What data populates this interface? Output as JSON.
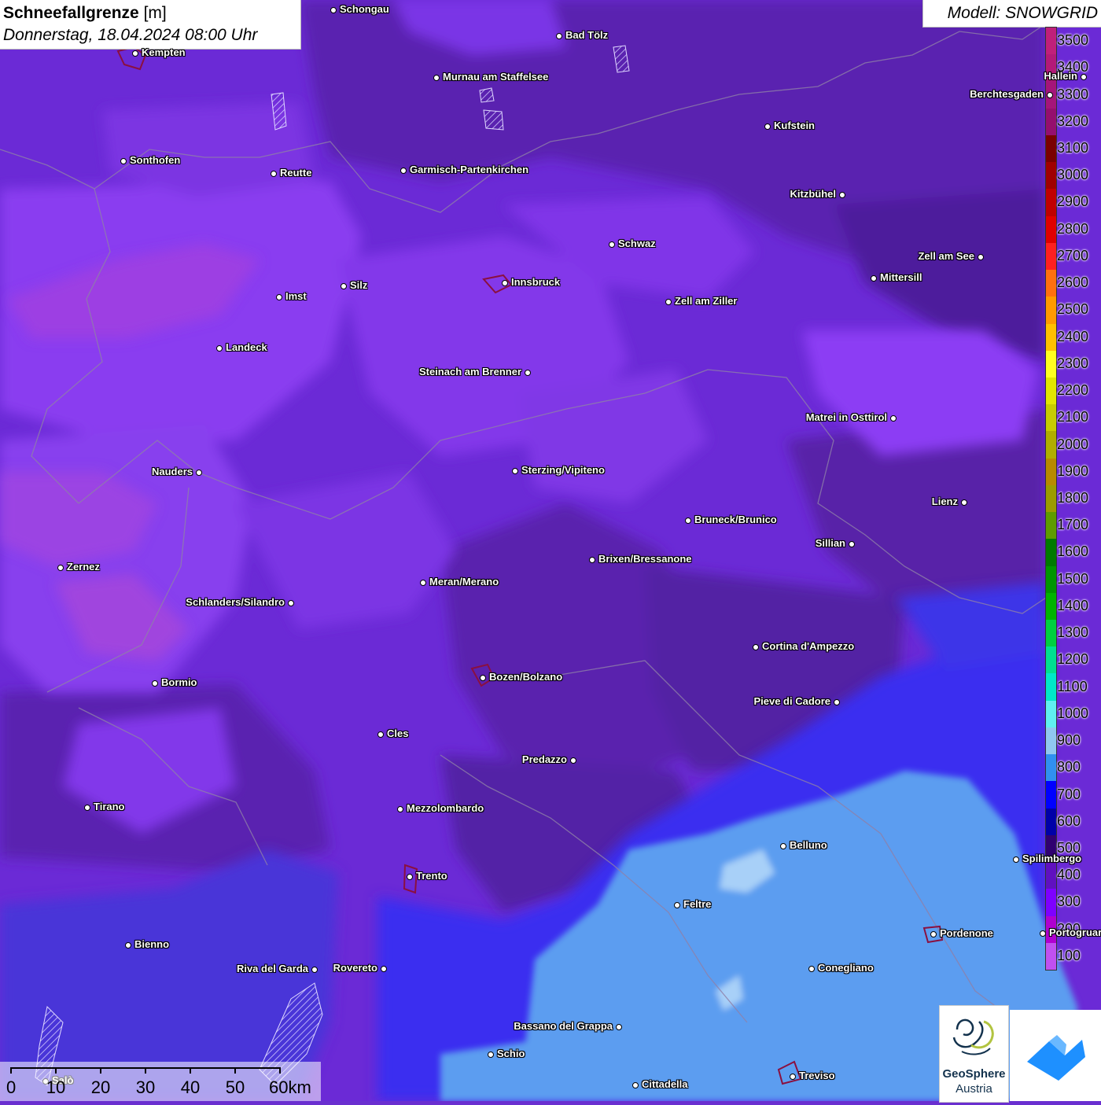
{
  "header": {
    "title": "Schneefallgrenze",
    "unit": "[m]",
    "datetime": "Donnerstag, 18.04.2024 08:00 Uhr"
  },
  "model": {
    "label": "Modell: SNOWGRID"
  },
  "legend": {
    "entries": [
      {
        "label": "3500",
        "color": "#c0207a"
      },
      {
        "label": "3400",
        "color": "#b31a78"
      },
      {
        "label": "3300",
        "color": "#a5157a"
      },
      {
        "label": "3200",
        "color": "#950f6e"
      },
      {
        "label": "3100",
        "color": "#7a0000"
      },
      {
        "label": "3000",
        "color": "#a00000"
      },
      {
        "label": "2900",
        "color": "#c00000"
      },
      {
        "label": "2800",
        "color": "#e00000"
      },
      {
        "label": "2700",
        "color": "#ff2020"
      },
      {
        "label": "2600",
        "color": "#ff7010"
      },
      {
        "label": "2500",
        "color": "#ff9a00"
      },
      {
        "label": "2400",
        "color": "#ffc000"
      },
      {
        "label": "2300",
        "color": "#ffff20"
      },
      {
        "label": "2200",
        "color": "#e2e600"
      },
      {
        "label": "2100",
        "color": "#c8cc00"
      },
      {
        "label": "2000",
        "color": "#b0ae00"
      },
      {
        "label": "1900",
        "color": "#b88a00"
      },
      {
        "label": "1800",
        "color": "#9c9c00"
      },
      {
        "label": "1700",
        "color": "#5e9c00"
      },
      {
        "label": "1600",
        "color": "#007a00"
      },
      {
        "label": "1500",
        "color": "#009600"
      },
      {
        "label": "1400",
        "color": "#00b400"
      },
      {
        "label": "1300",
        "color": "#00d040"
      },
      {
        "label": "1200",
        "color": "#00e090"
      },
      {
        "label": "1100",
        "color": "#00e8c8"
      },
      {
        "label": "1000",
        "color": "#60f0f0"
      },
      {
        "label": "900",
        "color": "#90c8f0"
      },
      {
        "label": "800",
        "color": "#3090f0"
      },
      {
        "label": "700",
        "color": "#0000ff"
      },
      {
        "label": "600",
        "color": "#0000a8"
      },
      {
        "label": "500",
        "color": "#300070"
      },
      {
        "label": "400",
        "color": "#6010c0"
      },
      {
        "label": "300",
        "color": "#7e00ff"
      },
      {
        "label": "200",
        "color": "#b000d0"
      },
      {
        "label": "100",
        "color": "#c050f0"
      }
    ],
    "clipped_label": "00"
  },
  "cities": [
    {
      "name": "Schongau",
      "align": "right"
    },
    {
      "name": "Bad Tölz",
      "align": "right"
    },
    {
      "name": "Kempten",
      "align": "right"
    },
    {
      "name": "Murnau am Staffelsee",
      "align": "right"
    },
    {
      "name": "Hallein",
      "align": "left"
    },
    {
      "name": "Berchtesgaden",
      "align": "left"
    },
    {
      "name": "Kufstein",
      "align": "right"
    },
    {
      "name": "Sonthofen",
      "align": "right"
    },
    {
      "name": "Reutte",
      "align": "right"
    },
    {
      "name": "Garmisch-Partenkirchen",
      "align": "right"
    },
    {
      "name": "Kitzbühel",
      "align": "left"
    },
    {
      "name": "Schwaz",
      "align": "right"
    },
    {
      "name": "Zell am See",
      "align": "left"
    },
    {
      "name": "Mittersill",
      "align": "right"
    },
    {
      "name": "Innsbruck",
      "align": "right"
    },
    {
      "name": "Imst",
      "align": "right"
    },
    {
      "name": "Silz",
      "align": "right"
    },
    {
      "name": "Zell am Ziller",
      "align": "right"
    },
    {
      "name": "Landeck",
      "align": "right"
    },
    {
      "name": "Steinach am Brenner",
      "align": "left"
    },
    {
      "name": "Matrei in Osttirol",
      "align": "left"
    },
    {
      "name": "Nauders",
      "align": "left"
    },
    {
      "name": "Sterzing/Vipiteno",
      "align": "right"
    },
    {
      "name": "Lienz",
      "align": "left"
    },
    {
      "name": "Bruneck/Brunico",
      "align": "right"
    },
    {
      "name": "Sillian",
      "align": "left"
    },
    {
      "name": "Zernez",
      "align": "right"
    },
    {
      "name": "Brixen/Bressanone",
      "align": "right"
    },
    {
      "name": "Meran/Merano",
      "align": "right"
    },
    {
      "name": "Schlanders/Silandro",
      "align": "left"
    },
    {
      "name": "Cortina d'Ampezzo",
      "align": "right"
    },
    {
      "name": "Bozen/Bolzano",
      "align": "right"
    },
    {
      "name": "Bormio",
      "align": "right"
    },
    {
      "name": "Pieve di Cadore",
      "align": "left"
    },
    {
      "name": "Cles",
      "align": "right"
    },
    {
      "name": "Predazzo",
      "align": "left"
    },
    {
      "name": "Tirano",
      "align": "right"
    },
    {
      "name": "Mezzolombardo",
      "align": "right"
    },
    {
      "name": "Belluno",
      "align": "right"
    },
    {
      "name": "Spilimbergo",
      "align": "right"
    },
    {
      "name": "Trento",
      "align": "right"
    },
    {
      "name": "Feltre",
      "align": "right"
    },
    {
      "name": "Pordenone",
      "align": "right"
    },
    {
      "name": "Bienno",
      "align": "right"
    },
    {
      "name": "Riva del Garda",
      "align": "left"
    },
    {
      "name": "Rovereto",
      "align": "left"
    },
    {
      "name": "Conegliano",
      "align": "right"
    },
    {
      "name": "Bassano del Grappa",
      "align": "left"
    },
    {
      "name": "Schio",
      "align": "right"
    },
    {
      "name": "Treviso",
      "align": "right"
    },
    {
      "name": "Cittadella",
      "align": "right"
    },
    {
      "name": "Salò",
      "align": "right"
    },
    {
      "name": "Portogruaro",
      "align": "right"
    }
  ],
  "scalebar": {
    "labels": [
      "0",
      "10",
      "20",
      "30",
      "40",
      "50",
      "60km"
    ]
  },
  "logos": {
    "geosphere_name": "GeoSphere",
    "geosphere_sub": "Austria"
  }
}
